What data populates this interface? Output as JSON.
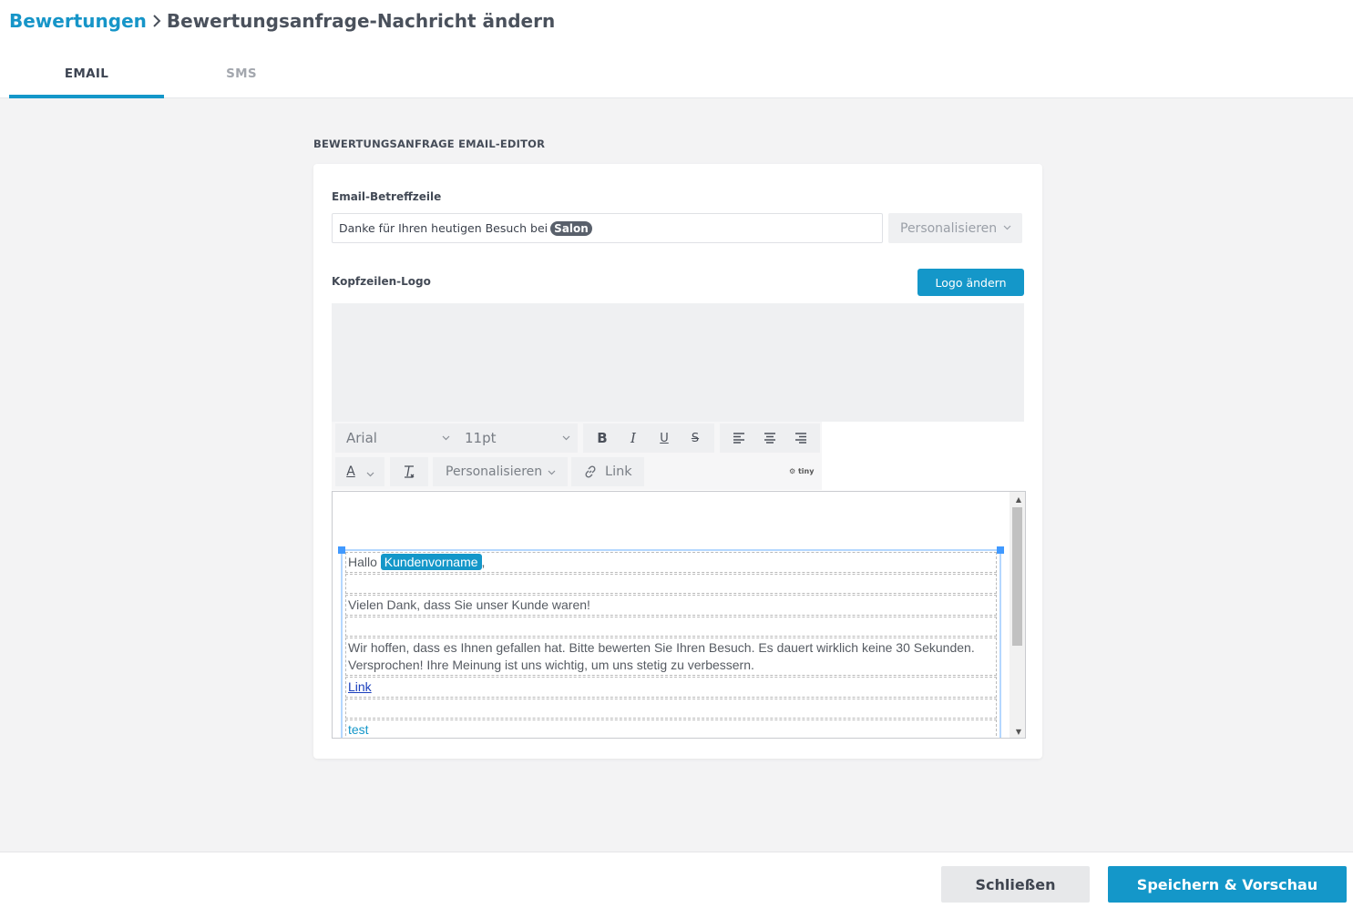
{
  "breadcrumb": {
    "parent": "Bewertungen",
    "current": "Bewertungsanfrage-Nachricht ändern"
  },
  "tabs": [
    {
      "label": "EMAIL",
      "active": true
    },
    {
      "label": "SMS",
      "active": false
    }
  ],
  "section_title": "BEWERTUNGSANFRAGE EMAIL-EDITOR",
  "subject": {
    "label": "Email-Betreffzeile",
    "text": "Danke für Ihren heutigen Besuch bei",
    "token": "Salon",
    "personalize_label": "Personalisieren"
  },
  "logo": {
    "label": "Kopfzeilen-Logo",
    "change_button": "Logo ändern"
  },
  "toolbar": {
    "font_family": "Arial",
    "font_size": "11pt",
    "bold": "B",
    "italic": "I",
    "underline": "U",
    "strikethrough": "S",
    "text_color": "A",
    "personalize": "Personalisieren",
    "link": "Link",
    "brand": "tiny"
  },
  "editor": {
    "greeting": "Hallo",
    "customer_token": "Kundenvorname",
    "comma": ",",
    "line1": "Vielen Dank, dass Sie unser Kunde waren!",
    "line2": "Wir hoffen, dass es Ihnen gefallen hat. Bitte bewerten Sie Ihren Besuch. Es dauert wirklich keine 30 Sekunden. Versprochen! Ihre Meinung ist uns wichtig, um uns stetig zu verbessern.",
    "link": "Link",
    "line3": "test"
  },
  "footer": {
    "close": "Schließen",
    "save": "Speichern & Vorschau"
  },
  "colors": {
    "accent": "#1497c9",
    "token_dark": "#59606b",
    "background": "#f3f3f4"
  }
}
